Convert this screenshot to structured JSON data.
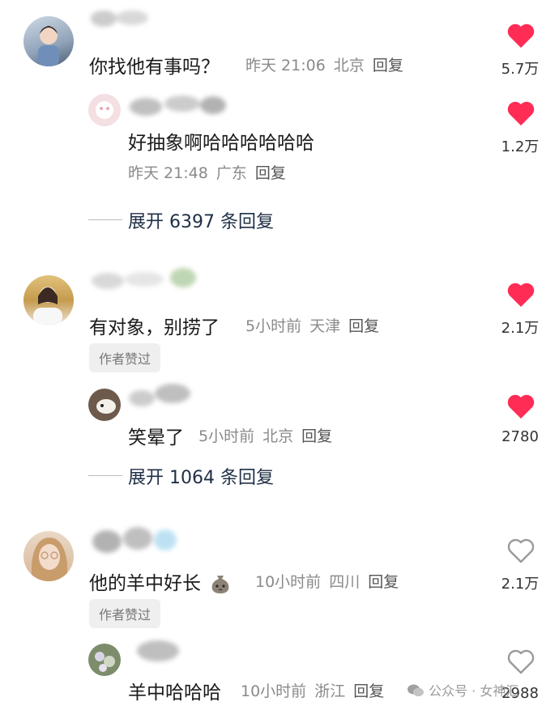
{
  "colors": {
    "like_active": "#FF2C55",
    "like_inactive": "#9a9a9a",
    "text_primary": "#1a1a1a",
    "text_meta": "#8a8a8a",
    "badge_bg": "#efefef"
  },
  "comments": [
    {
      "text": "你找他有事吗？",
      "time": "昨天 21:06",
      "location": "北京",
      "reply_label": "回复",
      "likes": "5.7万",
      "liked": true,
      "replies": [
        {
          "text": "好抽象啊哈哈哈哈哈哈",
          "time": "昨天 21:48",
          "location": "广东",
          "reply_label": "回复",
          "likes": "1.2万",
          "liked": true
        }
      ],
      "expand_label": "展开 6397 条回复"
    },
    {
      "text": "有对象，别捞了",
      "time": "5小时前",
      "location": "天津",
      "reply_label": "回复",
      "likes": "2.1万",
      "liked": true,
      "badge": "作者赞过",
      "replies": [
        {
          "text": "笑晕了",
          "time": "5小时前",
          "location": "北京",
          "reply_label": "回复",
          "likes": "2780",
          "liked": true
        }
      ],
      "expand_label": "展开 1064 条回复"
    },
    {
      "text": "他的羊中好长",
      "emoji": "money-bag-emoji",
      "time": "10小时前",
      "location": "四川",
      "reply_label": "回复",
      "likes": "2.1万",
      "liked": false,
      "badge": "作者赞过",
      "replies": [
        {
          "text": "羊中哈哈哈",
          "time": "10小时前",
          "location": "浙江",
          "reply_label": "回复",
          "likes": "2988",
          "liked": false
        }
      ]
    }
  ],
  "watermark": {
    "icon": "wechat-icon",
    "text": "公众号 · 女神汇"
  }
}
